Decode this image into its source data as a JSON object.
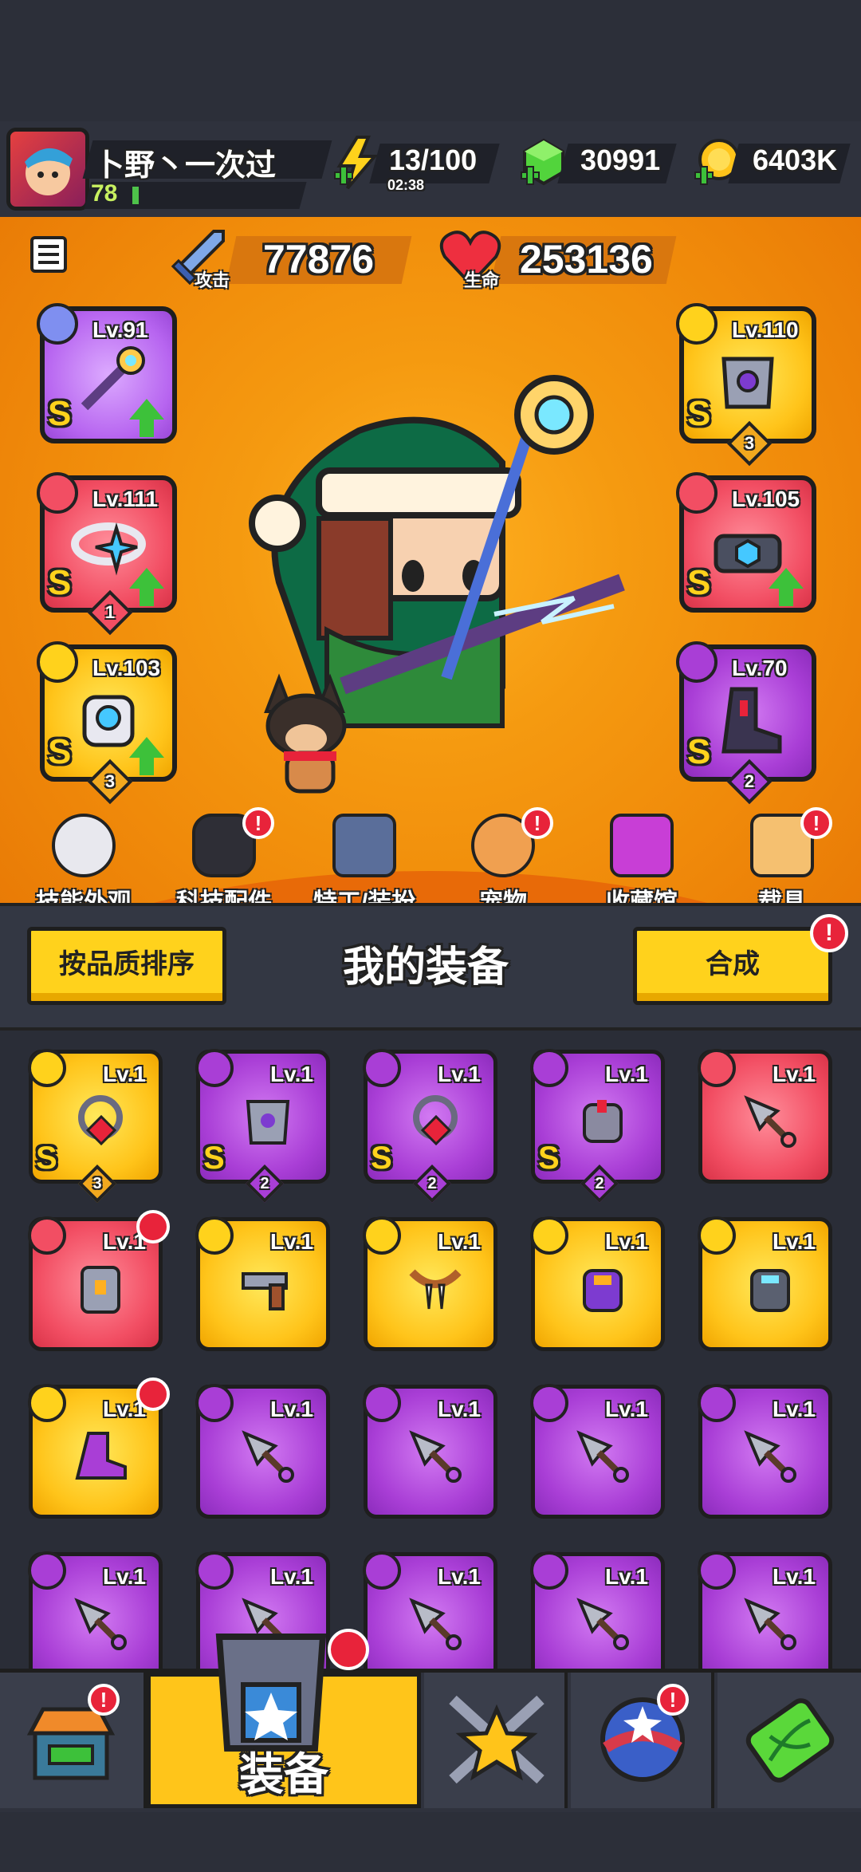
{
  "player": {
    "name": "卜野丶一次过",
    "level": "78"
  },
  "resources": {
    "energy": "13/100",
    "energy_timer": "02:38",
    "gems": "30991",
    "coins": "6403K"
  },
  "stats": {
    "attack_value": "77876",
    "attack_label": "攻击",
    "hp_value": "253136",
    "hp_label": "生命"
  },
  "equipped": {
    "left": [
      {
        "level": "Lv.91",
        "grade": "S",
        "stars": ""
      },
      {
        "level": "Lv.111",
        "grade": "S",
        "stars": "1"
      },
      {
        "level": "Lv.103",
        "grade": "S",
        "stars": "3"
      }
    ],
    "right": [
      {
        "level": "Lv.110",
        "grade": "S",
        "stars": "3"
      },
      {
        "level": "Lv.105",
        "grade": "S",
        "stars": ""
      },
      {
        "level": "Lv.70",
        "grade": "S",
        "stars": "2"
      }
    ]
  },
  "functions": [
    "技能外观",
    "科技配件",
    "特工/装扮",
    "宠物",
    "收藏馆",
    "载具"
  ],
  "my_equipment": {
    "sort_button": "按品质排序",
    "title": "我的装备",
    "merge_button": "合成"
  },
  "inventory": {
    "row1": [
      {
        "level": "Lv.1",
        "grade": "S",
        "stars": "3"
      },
      {
        "level": "Lv.1",
        "grade": "S",
        "stars": "2"
      },
      {
        "level": "Lv.1",
        "grade": "S",
        "stars": "2"
      },
      {
        "level": "Lv.1",
        "grade": "S",
        "stars": "2"
      },
      {
        "level": "Lv.1",
        "grade": "",
        "stars": ""
      }
    ],
    "row2": [
      "Lv.1",
      "Lv.1",
      "Lv.1",
      "Lv.1",
      "Lv.1"
    ],
    "row3": [
      "Lv.1",
      "Lv.1",
      "Lv.1",
      "Lv.1",
      "Lv.1"
    ],
    "row4": [
      "Lv.1",
      "Lv.1",
      "Lv.1",
      "Lv.1",
      "Lv.1"
    ]
  },
  "nav": {
    "active_label": "装备"
  },
  "colors": {
    "orange": "#f59a10",
    "gold": "#ffc41a",
    "purple": "#a93ed6",
    "red": "#f24e63",
    "badge": "#e8233a"
  }
}
